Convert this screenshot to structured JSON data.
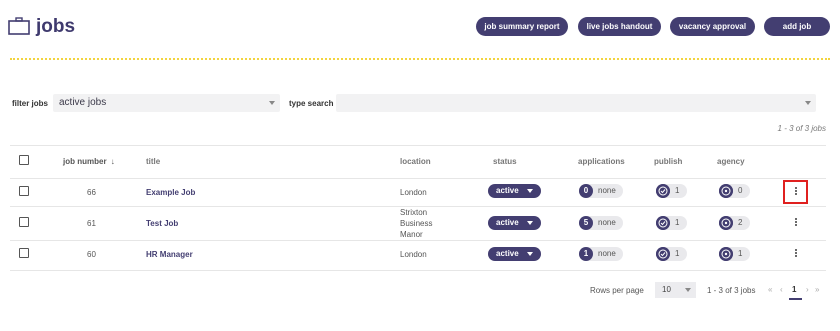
{
  "header": {
    "title": "jobs",
    "icon": "briefcase-icon",
    "buttons": {
      "job_summary_report": "job summary report",
      "live_jobs_handout": "live jobs handout",
      "vacancy_approval": "vacancy approval",
      "add_job": "add job"
    }
  },
  "filters": {
    "filter_label": "filter jobs",
    "filter_value": "active jobs",
    "type_label": "type search",
    "type_value": ""
  },
  "count_top": "1 - 3 of 3 jobs",
  "table": {
    "columns": {
      "job_number": "job number",
      "sort_indicator": "↓",
      "title": "title",
      "location": "location",
      "status": "status",
      "applications": "applications",
      "publish": "publish",
      "agency": "agency"
    },
    "rows": [
      {
        "job_number": "66",
        "title": "Example Job",
        "location": "London",
        "status": "active",
        "applications_count": "0",
        "applications_label": "none",
        "publish": "1",
        "agency": "0"
      },
      {
        "job_number": "61",
        "title": "Test Job",
        "location_lines": [
          "Strixton",
          "Business",
          "Manor"
        ],
        "status": "active",
        "applications_count": "5",
        "applications_label": "none",
        "publish": "1",
        "agency": "2"
      },
      {
        "job_number": "60",
        "title": "HR Manager",
        "location": "London",
        "status": "active",
        "applications_count": "1",
        "applications_label": "none",
        "publish": "1",
        "agency": "1"
      }
    ]
  },
  "footer": {
    "rows_per_page_label": "Rows per page",
    "rows_per_page_value": "10",
    "range": "1 - 3 of 3 jobs",
    "first": "«",
    "prev": "‹",
    "page": "1",
    "next": "›",
    "last": "»"
  },
  "colors": {
    "accent": "#433e71",
    "dotted_line": "#f2d43e",
    "highlight": "#e0201f"
  }
}
